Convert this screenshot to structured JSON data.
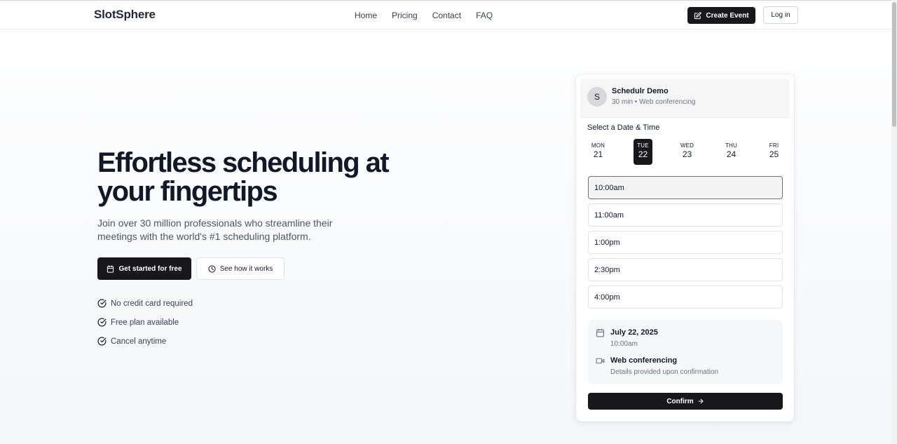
{
  "header": {
    "brand": "SlotSphere",
    "nav": [
      "Home",
      "Pricing",
      "Contact",
      "FAQ"
    ],
    "create_event_label": "Create Event",
    "login_label": "Log in"
  },
  "hero": {
    "title": "Effortless scheduling at your fingertips",
    "subtitle": "Join over 30 million professionals who streamline their meetings with the world's #1 scheduling platform.",
    "primary_cta": "Get started for free",
    "secondary_cta": "See how it works",
    "features": [
      "No credit card required",
      "Free plan available",
      "Cancel anytime"
    ]
  },
  "booking": {
    "avatar_initial": "S",
    "host_name": "Schedulr Demo",
    "meta": "30 min • Web conferencing",
    "select_label": "Select a Date & Time",
    "days": [
      {
        "dow": "MON",
        "num": "21"
      },
      {
        "dow": "TUE",
        "num": "22"
      },
      {
        "dow": "WED",
        "num": "23"
      },
      {
        "dow": "THU",
        "num": "24"
      },
      {
        "dow": "FRI",
        "num": "25"
      }
    ],
    "selected_day_index": 1,
    "slots": [
      "10:00am",
      "11:00am",
      "1:00pm",
      "2:30pm",
      "4:00pm"
    ],
    "selected_slot_index": 0,
    "summary": {
      "date": "July 22, 2025",
      "time": "10:00am",
      "conferencing": "Web conferencing",
      "details": "Details provided upon confirmation"
    },
    "confirm_label": "Confirm"
  },
  "colors": {
    "primary": "#18181b",
    "text": "#111827",
    "muted": "#6b7280",
    "border": "#e4e4e7"
  },
  "icons": [
    "pencil-square-icon",
    "calendar-icon",
    "clock-icon",
    "check-circle-icon",
    "video-icon",
    "arrow-right-icon"
  ]
}
